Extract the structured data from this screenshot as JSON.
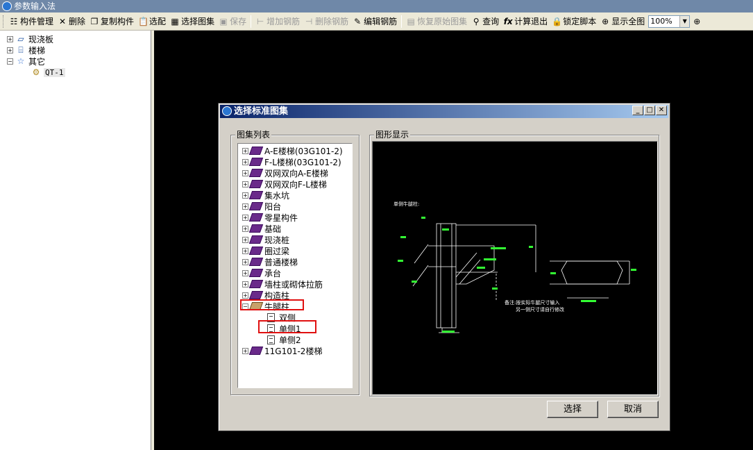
{
  "app": {
    "title": "参数输入法"
  },
  "toolbar": {
    "component_manage": "构件管理",
    "delete": "删除",
    "copy_component": "复制构件",
    "match": "选配",
    "select_atlas": "选择图集",
    "save": "保存",
    "add_rebar": "增加钢筋",
    "delete_rebar": "删除钢筋",
    "edit_rebar": "编辑钢筋",
    "restore_atlas": "恢复原始图集",
    "query": "查询",
    "calc_exit": "计算退出",
    "lock_script": "锁定脚本",
    "show_full": "显示全图",
    "zoom": "100%"
  },
  "left_tree": {
    "items": [
      {
        "label": "现浇板",
        "icon": "slab-icon"
      },
      {
        "label": "楼梯",
        "icon": "stair-icon"
      },
      {
        "label": "其它",
        "icon": "star-icon"
      },
      {
        "label": "QT-1",
        "icon": "gear-icon"
      }
    ]
  },
  "dialog": {
    "title": "选择标准图集",
    "list_group_label": "图集列表",
    "preview_group_label": "图形显示",
    "select_button": "选择",
    "cancel_button": "取消",
    "atlas_items": [
      "A-E楼梯(03G101-2)",
      "F-L楼梯(03G101-2)",
      "双网双向A-E楼梯",
      "双网双向F-L楼梯",
      "集水坑",
      "阳台",
      "零星构件",
      "基础",
      "现浇桩",
      "圈过梁",
      "普通楼梯",
      "承台",
      "墙柱或砌体拉筋",
      "构造柱",
      "牛腿柱",
      "11G101-2楼梯"
    ],
    "niutui_children": [
      "双侧",
      "单侧1",
      "单侧2"
    ],
    "preview": {
      "heading": "单侧牛腿柱:",
      "note_line1": "备注:按实际牛腿尺寸输入",
      "note_line2": "另一侧尺寸请自行修改"
    }
  },
  "colors": {
    "title_gradient_start": "#0a246a",
    "highlight": "#e01010",
    "drawing_line": "#ffffff",
    "drawing_accent": "#33ff33"
  }
}
